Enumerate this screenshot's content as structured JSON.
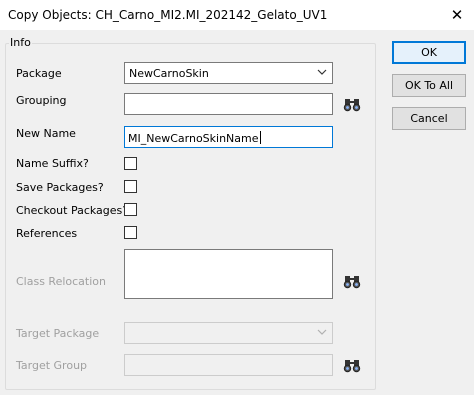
{
  "window": {
    "title": "Copy Objects: CH_Carno_MI2.MI_202142_Gelato_UV1",
    "close_glyph": "✕"
  },
  "info_group": {
    "title": "Info",
    "package": {
      "label": "Package",
      "value": "NewCarnoSkin"
    },
    "grouping": {
      "label": "Grouping",
      "value": ""
    },
    "new_name": {
      "label": "New Name",
      "value": "MI_NewCarnoSkinName"
    },
    "name_suffix": {
      "label": "Name Suffix?",
      "checked": false
    },
    "save_packages": {
      "label": "Save Packages?",
      "checked": false
    },
    "checkout_packages": {
      "label": "Checkout Packages?",
      "checked": false
    },
    "references": {
      "label": "References",
      "checked": false
    },
    "class_relocation": {
      "label": "Class Relocation",
      "value": ""
    },
    "target_package": {
      "label": "Target Package",
      "value": ""
    },
    "target_group": {
      "label": "Target Group",
      "value": ""
    }
  },
  "buttons": {
    "ok": "OK",
    "ok_to_all": "OK To All",
    "cancel": "Cancel"
  },
  "icons": {
    "find": "binoculars-icon",
    "dropdown": "chevron-down-icon",
    "close": "close-icon"
  },
  "colors": {
    "focus_border": "#0078d7",
    "disabled_text": "#a0a0a0"
  }
}
